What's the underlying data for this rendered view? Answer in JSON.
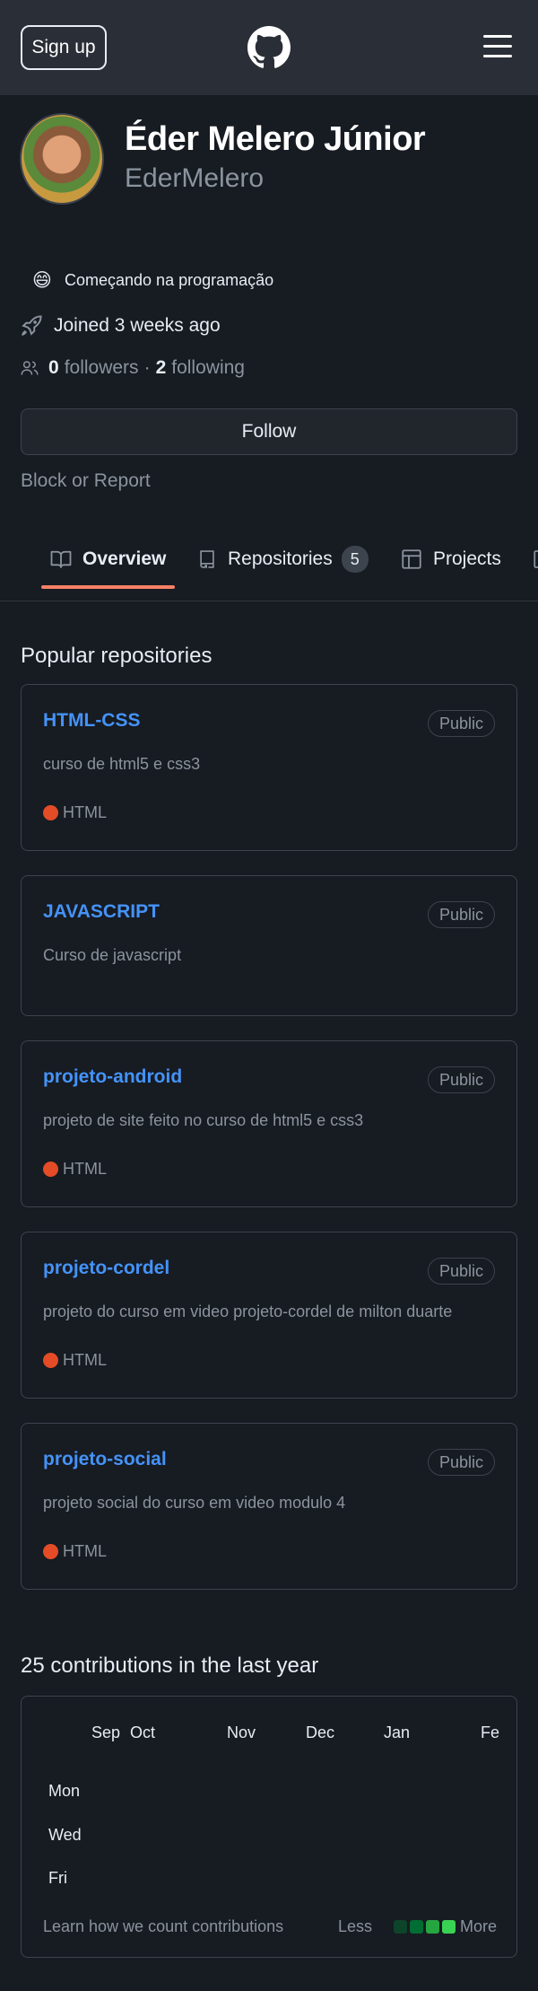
{
  "header": {
    "signup_label": "Sign up",
    "logo_icon": "github-mark-icon",
    "menu_icon": "hamburger-menu-icon"
  },
  "profile": {
    "full_name": "Éder Melero Júnior",
    "username": "EderMelero",
    "status_emoji": "😄",
    "status_text": "Começando na programação",
    "joined": "Joined 3 weeks ago",
    "followers_count": "0",
    "followers_label": "followers",
    "separator": "·",
    "following_count": "2",
    "following_label": "following",
    "follow_button": "Follow",
    "block_report": "Block or Report"
  },
  "tabs": [
    {
      "label": "Overview",
      "icon": "book-icon",
      "selected": true
    },
    {
      "label": "Repositories",
      "icon": "repo-icon",
      "count": "5"
    },
    {
      "label": "Projects",
      "icon": "table-icon"
    }
  ],
  "popular": {
    "title": "Popular repositories",
    "repos": [
      {
        "name": "HTML-CSS",
        "visibility": "Public",
        "description": "curso de html5 e css3",
        "language": "HTML"
      },
      {
        "name": "JAVASCRIPT",
        "visibility": "Public",
        "description": "Curso de javascript",
        "language": ""
      },
      {
        "name": "projeto-android",
        "visibility": "Public",
        "description": "projeto de site feito no curso de html5 e css3",
        "language": "HTML"
      },
      {
        "name": "projeto-cordel",
        "visibility": "Public",
        "description": "projeto do curso em video projeto-cordel de milton duarte",
        "language": "HTML"
      },
      {
        "name": "projeto-social",
        "visibility": "Public",
        "description": "projeto social do curso em video modulo 4",
        "language": "HTML"
      }
    ],
    "language_color": "#e34c26"
  },
  "contributions": {
    "title": "25 contributions in the last year",
    "months": [
      "Sep",
      "Oct",
      "Nov",
      "Dec",
      "Jan",
      "Fe"
    ],
    "days": [
      "Mon",
      "Wed",
      "Fri"
    ],
    "learn_link": "Learn how we count contributions",
    "legend_less": "Less",
    "legend_more": "More",
    "legend_colors": [
      "#0e4429",
      "#006d32",
      "#26a641",
      "#39d353"
    ]
  }
}
